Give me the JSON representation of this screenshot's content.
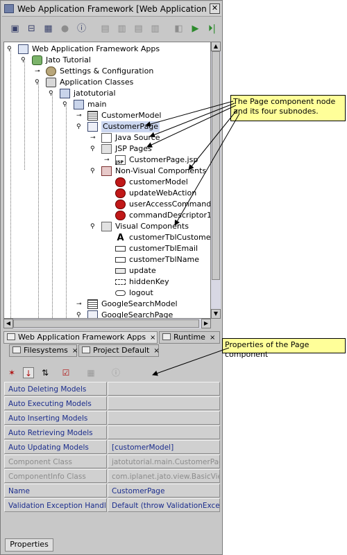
{
  "window": {
    "title": "Web Application Framework [Web Application Framework",
    "close_glyph": "✕"
  },
  "toolbar": {
    "icons": [
      "new-project-icon",
      "open-icon",
      "save-icon",
      "run-disabled-icon",
      "help-icon",
      "tool-disabled-icon-1",
      "tool-disabled-icon-2",
      "tool-disabled-icon-3",
      "tool-disabled-icon-4",
      "tool-disabled-icon-5",
      "run-icon",
      "run-all-icon"
    ]
  },
  "tree": {
    "nodes": [
      {
        "label": "Web Application Framework Apps",
        "icon": "apps-root-icon"
      },
      {
        "label": "Jato Tutorial",
        "icon": "application-icon"
      },
      {
        "label": "Settings & Configuration",
        "icon": "settings-icon"
      },
      {
        "label": "Application Classes",
        "icon": "classes-icon"
      },
      {
        "label": "jatotutorial",
        "icon": "package-folder-icon"
      },
      {
        "label": "main",
        "icon": "module-icon"
      },
      {
        "label": "CustomerModel",
        "icon": "model-table-icon"
      },
      {
        "label": "CustomerPage",
        "icon": "page-icon"
      },
      {
        "label": "Java Source",
        "icon": "java-source-icon"
      },
      {
        "label": "JSP Pages",
        "icon": "jsp-folder-icon"
      },
      {
        "label": "CustomerPage.jsp",
        "icon": "jsp-file-icon",
        "badge": "JSP"
      },
      {
        "label": "Non-Visual Components",
        "icon": "non-visual-folder-icon"
      },
      {
        "label": "customerModel",
        "icon": "bean-icon"
      },
      {
        "label": "updateWebAction",
        "icon": "bean-icon"
      },
      {
        "label": "userAccessCommand",
        "icon": "bean-icon"
      },
      {
        "label": "commandDescriptor1",
        "icon": "bean-icon"
      },
      {
        "label": "Visual Components",
        "icon": "visual-folder-icon"
      },
      {
        "label": "customerTblCustomerNum",
        "icon": "static-text-icon"
      },
      {
        "label": "customerTblEmail",
        "icon": "text-field-icon"
      },
      {
        "label": "customerTblName",
        "icon": "text-field-icon"
      },
      {
        "label": "update",
        "icon": "button-icon"
      },
      {
        "label": "hiddenKey",
        "icon": "hidden-field-icon"
      },
      {
        "label": "logout",
        "icon": "href-icon"
      },
      {
        "label": "GoogleSearchModel",
        "icon": "model-table-icon"
      },
      {
        "label": "GoogleSearchPage",
        "icon": "page-icon"
      }
    ]
  },
  "explorer_tabs": [
    {
      "label": "Web Application Framework Apps",
      "close": "×"
    },
    {
      "label": "Runtime",
      "close": "×"
    },
    {
      "label": "Filesystems",
      "close": "×"
    },
    {
      "label": "Project Default",
      "close": "×"
    }
  ],
  "property_toolbar": {
    "icons": [
      "sort-unsorted-icon",
      "sort-by-name-icon",
      "sort-by-type-icon",
      "filter-icon",
      "customize-icon",
      "help-icon"
    ]
  },
  "properties": [
    {
      "name": "Auto Deleting Models",
      "value": "",
      "readonly": false
    },
    {
      "name": "Auto Executing Models",
      "value": "",
      "readonly": false
    },
    {
      "name": "Auto Inserting Models",
      "value": "",
      "readonly": false
    },
    {
      "name": "Auto Retrieving Models",
      "value": "",
      "readonly": false
    },
    {
      "name": "Auto Updating Models",
      "value": "[customerModel]",
      "readonly": false
    },
    {
      "name": "Component Class",
      "value": "jatotutorial.main.CustomerPage",
      "readonly": true
    },
    {
      "name": "ComponentInfo Class",
      "value": "com.iplanet.jato.view.BasicView",
      "readonly": true
    },
    {
      "name": "Name",
      "value": "CustomerPage",
      "readonly": false
    },
    {
      "name": "Validation Exception Handler",
      "value": "Default (throw ValidationExcepti",
      "readonly": false
    }
  ],
  "properties_tab": {
    "label": "Properties"
  },
  "callouts": {
    "page_node": "The Page component node and its four subnodes.",
    "properties": "Properties of the Page component"
  }
}
